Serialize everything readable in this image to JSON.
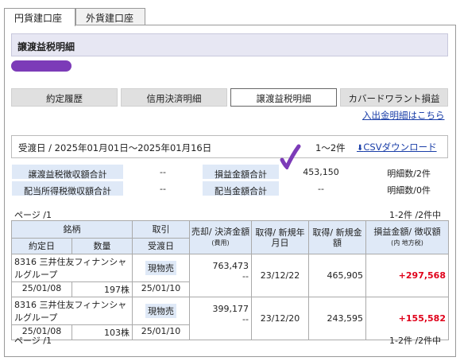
{
  "account_tabs": [
    {
      "label": "円貨建口座",
      "active": true
    },
    {
      "label": "外貨建口座",
      "active": false
    }
  ],
  "section_title": "譲渡益税明細",
  "sub_tabs": [
    {
      "label": "約定履歴"
    },
    {
      "label": "信用決済明細"
    },
    {
      "label": "譲渡益税明細"
    },
    {
      "label": "カバードワラント損益"
    }
  ],
  "deposit_link": "入出金明細はこちら",
  "date_range": "受渡日 / 2025年01月01日〜2025年01月16日",
  "count_range": "1〜2件",
  "csv_label": "CSVダウンロード",
  "summary": {
    "row1": {
      "h1": "譲渡益税徴収額合計",
      "v1": "--",
      "h2": "損益金額合計",
      "v2": "453,150",
      "count": "明細数/2件"
    },
    "row2": {
      "h1": "配当所得税徴収額合計",
      "v1": "--",
      "h2": "配当金額合計",
      "v2": "--",
      "count": "明細数/0件"
    }
  },
  "page_label": "ページ /1",
  "items_label": "1-2件 /2件中",
  "table_headers": {
    "issue": "銘柄",
    "trade_date": "約定日",
    "qty": "数量",
    "deal": "取引",
    "settle_date": "受渡日",
    "sale_amount": "売却/ 決済金額",
    "fee": "(費用)",
    "acq_date": "取得/ 新規年月日",
    "acq_amount": "取得/ 新規金額",
    "pnl": "損益金額/ 徴収額",
    "pnl_note": "(内 地方税)"
  },
  "rows": [
    {
      "issue": "8316 三井住友フィナンシャルグループ",
      "trade_date": "25/01/08",
      "qty": "197株",
      "deal": "現物売",
      "settle_date": "25/01/10",
      "sale_amount": "763,473",
      "fee": "--",
      "acq_date": "23/12/22",
      "acq_amount": "465,905",
      "pnl": "+297,568"
    },
    {
      "issue": "8316 三井住友フィナンシャルグループ",
      "trade_date": "25/01/08",
      "qty": "103株",
      "deal": "現物売",
      "settle_date": "25/01/10",
      "sale_amount": "399,177",
      "fee": "--",
      "acq_date": "23/12/20",
      "acq_amount": "243,595",
      "pnl": "+155,582"
    }
  ],
  "footer_page": "ページ /1",
  "footer_items": "1-2件 /2件中",
  "colors": {
    "accent": "#1a3ea8",
    "header_bg": "#dfe9f7",
    "profit": "#e0001a",
    "marker": "#7c3bb8"
  }
}
